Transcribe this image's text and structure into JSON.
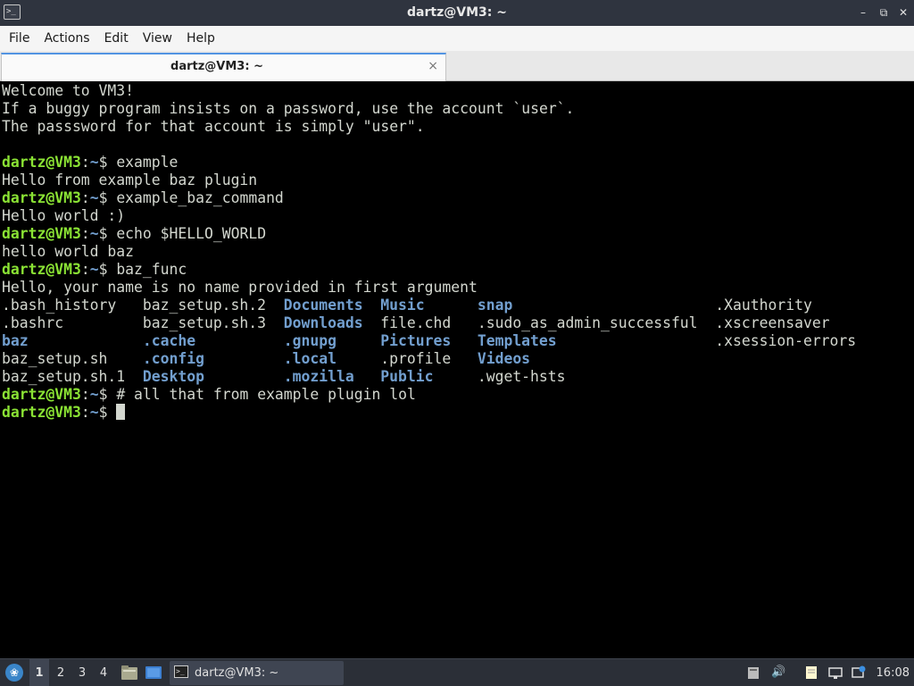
{
  "window": {
    "title": "dartz@VM3: ~",
    "app_icon": "terminal-icon",
    "buttons": {
      "minimize": "–",
      "maximize": "⧉",
      "close": "✕"
    }
  },
  "menubar": {
    "items": [
      "File",
      "Actions",
      "Edit",
      "View",
      "Help"
    ]
  },
  "tabs": [
    {
      "label": "dartz@VM3: ~",
      "close": "×"
    }
  ],
  "terminal": {
    "prompt_user": "dartz@VM3",
    "prompt_sep": ":",
    "prompt_path": "~",
    "prompt_end": "$ ",
    "welcome": [
      "Welcome to VM3!",
      "If a buggy program insists on a password, use the account `user`.",
      "The passsword for that account is simply \"user\".",
      ""
    ],
    "commands": [
      {
        "cmd": "example",
        "output": [
          "Hello from example baz plugin"
        ]
      },
      {
        "cmd": "example_baz_command",
        "output": [
          "Hello world :)"
        ]
      },
      {
        "cmd": "echo $HELLO_WORLD",
        "output": [
          "hello world baz"
        ]
      },
      {
        "cmd": "baz_func",
        "output": [
          "Hello, your name is no name provided in first argument"
        ]
      }
    ],
    "ls_listing": [
      [
        ".bash_history",
        "baz_setup.sh.2",
        "Documents",
        "Music",
        "snap",
        ".Xauthority"
      ],
      [
        ".bashrc",
        "baz_setup.sh.3",
        "Downloads",
        "file.chd",
        ".sudo_as_admin_successful",
        ".xscreensaver"
      ],
      [
        "baz",
        ".cache",
        ".gnupg",
        "Pictures",
        "Templates",
        ".xsession-errors"
      ],
      [
        "baz_setup.sh",
        ".config",
        ".local",
        ".profile",
        "Videos",
        ""
      ],
      [
        "baz_setup.sh.1",
        "Desktop",
        ".mozilla",
        "Public",
        ".wget-hsts",
        ""
      ]
    ],
    "ls_dirs": [
      "baz",
      "Documents",
      "Downloads",
      ".cache",
      ".config",
      "Desktop",
      ".gnupg",
      ".local",
      ".mozilla",
      "Music",
      "Pictures",
      "Public",
      "snap",
      "Templates",
      "Videos"
    ],
    "after_commands": [
      {
        "cmd": "# all that from example plugin lol"
      }
    ]
  },
  "taskbar": {
    "start_icon": "lxqt-menu-icon",
    "workspaces": [
      "1",
      "2",
      "3",
      "4"
    ],
    "active_workspace": "1",
    "quicklaunch": [
      "file-manager-icon",
      "show-desktop-icon"
    ],
    "task_label": "dartz@VM3: ~",
    "tray": [
      "clipboard-icon",
      "volume-icon",
      "notes-icon",
      "network-icon",
      "updates-icon"
    ],
    "clock": "16:08"
  }
}
